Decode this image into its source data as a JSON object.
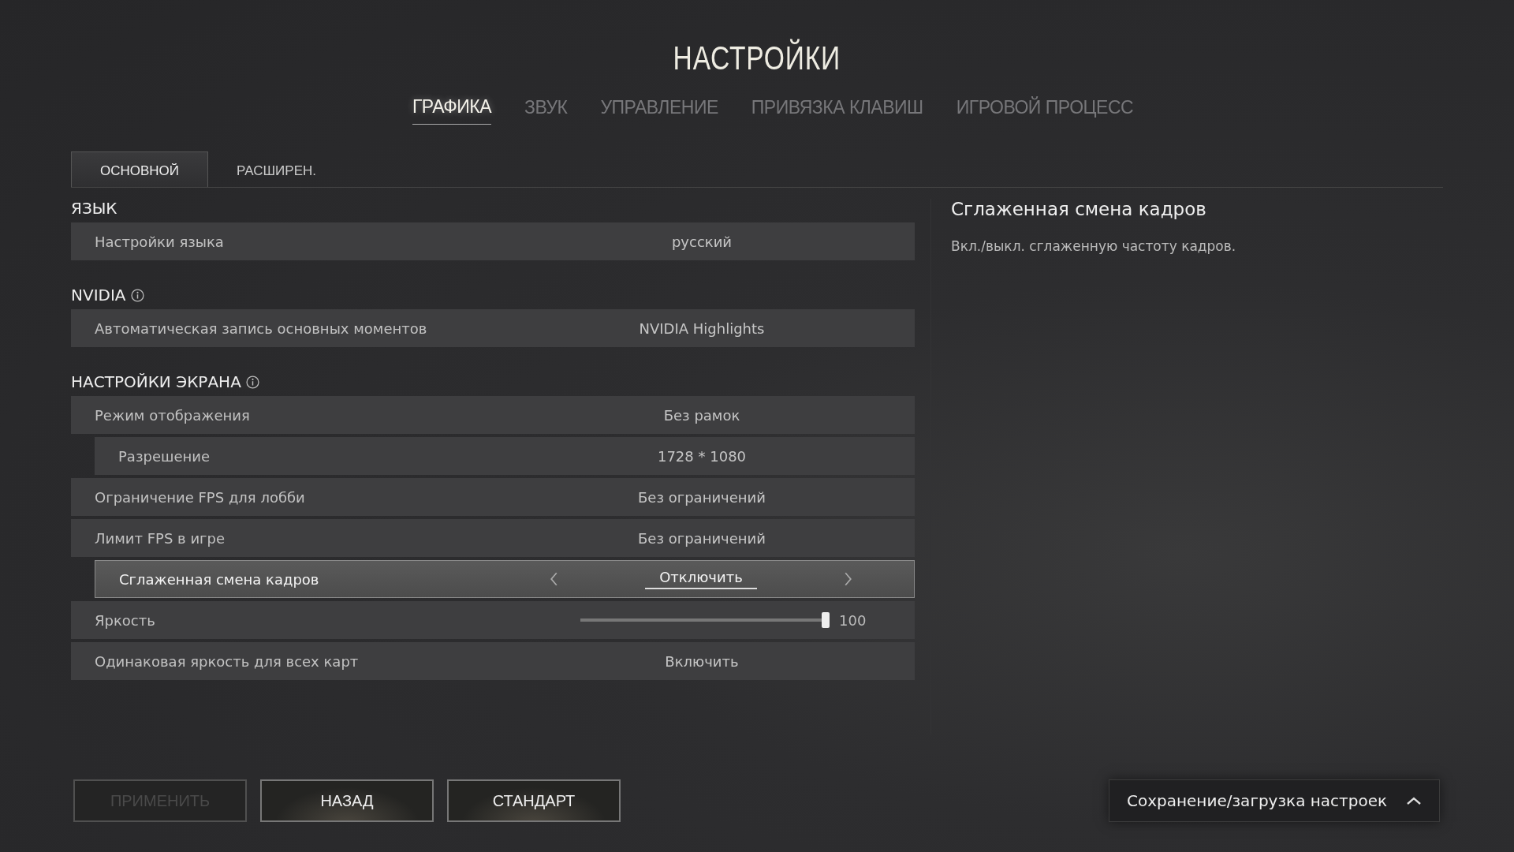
{
  "title": "НАСТРОЙКИ",
  "tabs": [
    {
      "label": "ГРАФИКА",
      "selected": true
    },
    {
      "label": "ЗВУК",
      "selected": false
    },
    {
      "label": "УПРАВЛЕНИЕ",
      "selected": false
    },
    {
      "label": "ПРИВЯЗКА КЛАВИШ",
      "selected": false
    },
    {
      "label": "ИГРОВОЙ ПРОЦЕСС",
      "selected": false
    }
  ],
  "subtabs": [
    {
      "label": "ОСНОВНОЙ",
      "selected": true
    },
    {
      "label": "РАСШИРЕН.",
      "selected": false
    }
  ],
  "sections": [
    {
      "heading": "ЯЗЫК",
      "info": false,
      "rows": [
        {
          "kind": "value",
          "label": "Настройки языка",
          "value": "русский",
          "indented": false,
          "selected": false
        }
      ]
    },
    {
      "heading": "NVIDIA",
      "info": true,
      "rows": [
        {
          "kind": "value",
          "label": "Автоматическая запись основных моментов",
          "value": "NVIDIA Highlights",
          "indented": false,
          "selected": false
        }
      ]
    },
    {
      "heading": "НАСТРОЙКИ ЭКРАНА",
      "info": true,
      "rows": [
        {
          "kind": "value",
          "label": "Режим отображения",
          "value": "Без рамок",
          "indented": false,
          "selected": false
        },
        {
          "kind": "value",
          "label": "Разрешение",
          "value": "1728 * 1080",
          "indented": true,
          "selected": false
        },
        {
          "kind": "value",
          "label": "Ограничение FPS для лобби",
          "value": "Без ограничений",
          "indented": false,
          "selected": false
        },
        {
          "kind": "value",
          "label": "Лимит FPS в игре",
          "value": "Без ограничений",
          "indented": false,
          "selected": false
        },
        {
          "kind": "value",
          "label": "Сглаженная смена кадров",
          "value": "Отключить",
          "indented": true,
          "selected": true
        },
        {
          "kind": "slider",
          "label": "Яркость",
          "level": 1.0,
          "value": "100",
          "indented": false,
          "selected": false
        },
        {
          "kind": "value",
          "label": "Одинаковая яркость для всех карт",
          "value": "Включить",
          "indented": false,
          "selected": false
        }
      ]
    }
  ],
  "detail": {
    "title": "Сглаженная смена кадров",
    "description": "Вкл./выкл. сглаженную частоту кадров."
  },
  "buttons": [
    {
      "label": "ПРИМЕНИТЬ",
      "disabled": true
    },
    {
      "label": "НАЗАД",
      "disabled": false
    },
    {
      "label": "СТАНДАРТ",
      "disabled": false
    }
  ],
  "presets": {
    "label": "Сохранение/загрузка настроек"
  }
}
